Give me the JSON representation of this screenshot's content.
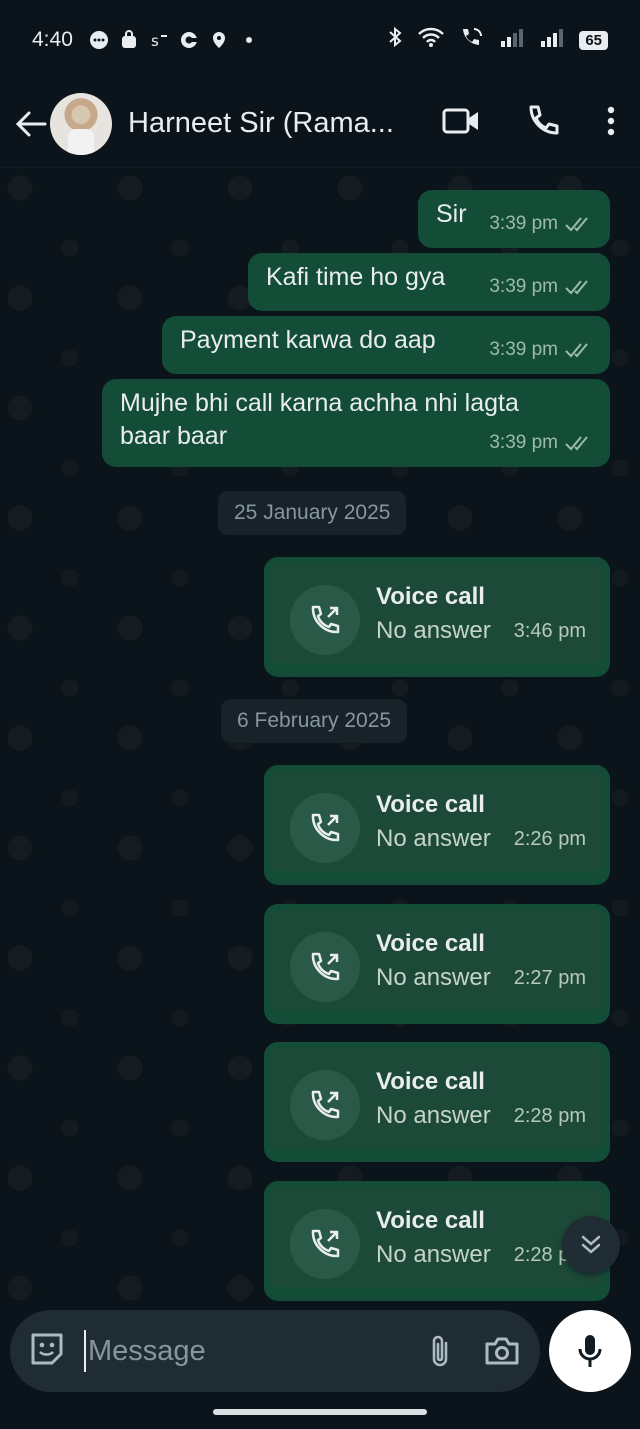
{
  "status_bar": {
    "time": "4:40",
    "battery": "65"
  },
  "header": {
    "contact_name": "Harneet Sir (Rama..."
  },
  "messages": [
    {
      "text": "Sir",
      "time": "3:39 pm"
    },
    {
      "text": "Kafi time ho gya",
      "time": "3:39 pm"
    },
    {
      "text": "Payment karwa do aap",
      "time": "3:39 pm"
    },
    {
      "text": "Mujhe bhi call karna achha nhi lagta baar baar",
      "time": "3:39 pm"
    }
  ],
  "date_chips": [
    "25 January 2025",
    "6 February 2025"
  ],
  "calls": [
    {
      "title": "Voice call",
      "status": "No answer",
      "time": "3:46 pm"
    },
    {
      "title": "Voice call",
      "status": "No answer",
      "time": "2:26 pm"
    },
    {
      "title": "Voice call",
      "status": "No answer",
      "time": "2:27 pm"
    },
    {
      "title": "Voice call",
      "status": "No answer",
      "time": "2:28 pm"
    },
    {
      "title": "Voice call",
      "status": "No answer",
      "time": "2:28 pm"
    }
  ],
  "composer": {
    "placeholder": "Message"
  },
  "colors": {
    "bubble_outgoing": "#144d37",
    "background": "#0b141a",
    "tick_read": "#9dbbaa"
  }
}
